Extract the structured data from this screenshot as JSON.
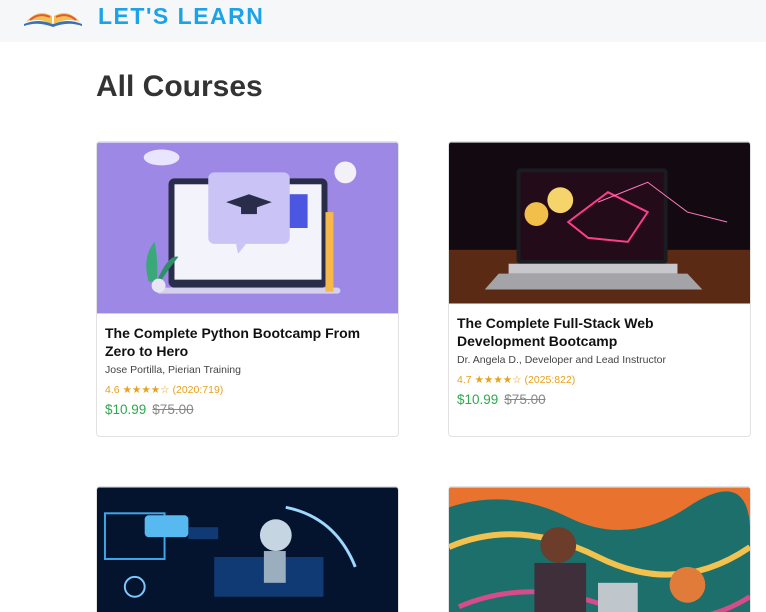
{
  "header": {
    "brand": "LET'S LEARN",
    "logo_icon": "open-book-icon",
    "brand_color": "#1aa3e8"
  },
  "main": {
    "title": "All Courses"
  },
  "courses": [
    {
      "title": "The Complete Python Bootcamp From Zero to Hero",
      "instructor": "Jose Portilla, Pierian Training",
      "rating": "4.6 ★★★★☆ (2020:719)",
      "price": "$10.99",
      "old_price": "$75.00"
    },
    {
      "title": "The Complete Full-Stack Web Development Bootcamp",
      "instructor": "Dr. Angela D., Developer and Lead Instructor",
      "rating": "4.7 ★★★★☆ (2025:822)",
      "price": "$10.99",
      "old_price": "$75.00"
    },
    {},
    {}
  ],
  "colors": {
    "price": "#2fa84f",
    "rating": "#e8a11b"
  }
}
